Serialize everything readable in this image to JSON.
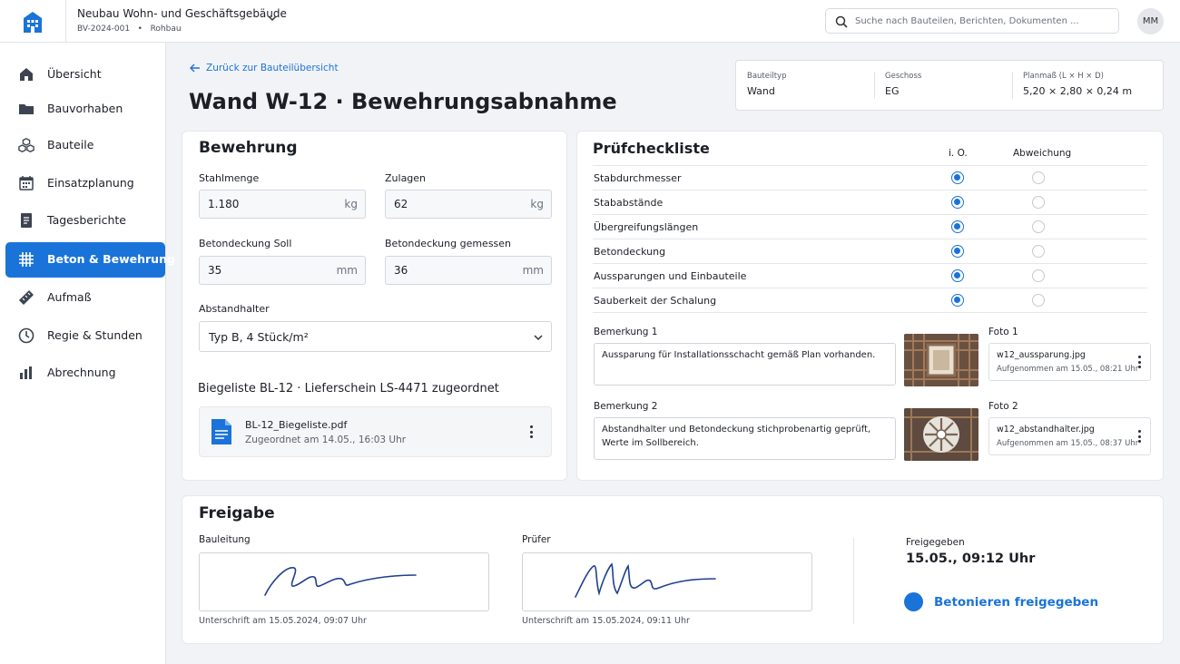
{
  "project": {
    "title": "Neubau Wohn- und Geschäftsgebäude",
    "subtitle": "BV-2024-001   •   Rohbau"
  },
  "search": {
    "placeholder": "Suche nach Bauteilen, Berichten, Dokumenten ..."
  },
  "user": {
    "initials": "MM"
  },
  "colors": {
    "accent": "#1a73d9",
    "background": "#f2f3f6"
  },
  "sidebar": {
    "items": [
      {
        "label": "Übersicht",
        "icon": "home-icon"
      },
      {
        "label": "Bauvorhaben",
        "icon": "folder-icon"
      },
      {
        "label": "Bauteile",
        "icon": "cubes-icon"
      },
      {
        "label": "Einsatzplanung",
        "icon": "calendar-icon"
      },
      {
        "label": "Tagesberichte",
        "icon": "document-icon"
      },
      {
        "label": "Beton & Bewehrung",
        "icon": "grid-icon",
        "active": true
      },
      {
        "label": "Aufmaß",
        "icon": "ruler-icon"
      },
      {
        "label": "Regie & Stunden",
        "icon": "clock-icon"
      },
      {
        "label": "Abrechnung",
        "icon": "bar-chart-icon"
      }
    ]
  },
  "main": {
    "back_link": "Zurück zur Bauteilübersicht",
    "title": "Wand W-12 · Bewehrungsabnahme",
    "meta": [
      {
        "key": "Bauteiltyp",
        "value": "Wand"
      },
      {
        "key": "Geschoss",
        "value": "EG"
      },
      {
        "key": "Planmaß (L × H × D)",
        "value": "5,20 × 2,80 × 0,24 m"
      }
    ]
  },
  "bewehrung": {
    "title": "Bewehrung",
    "stahlmenge": {
      "label": "Stahlmenge",
      "value": "1.180",
      "unit": "kg"
    },
    "zulagen": {
      "label": "Zulagen",
      "value": "62",
      "unit": "kg"
    },
    "betondeckung_soll": {
      "label": "Betondeckung Soll",
      "value": "35",
      "unit": "mm"
    },
    "betondeckung_gemessen": {
      "label": "Betondeckung gemessen",
      "value": "36",
      "unit": "mm"
    },
    "abstandhalter": {
      "label": "Abstandhalter",
      "value": "Typ B, 4 Stück/m²"
    },
    "biegeliste_title": "Biegeliste BL-12 · Lieferschein LS-4471 zugeordnet",
    "file": {
      "name": "BL-12_Biegeliste.pdf",
      "sub": "Zugeordnet am 14.05., 16:03 Uhr"
    }
  },
  "checklist": {
    "title": "Prüfcheckliste",
    "col_ok": "i. O.",
    "col_dev": "Abweichung",
    "rows": [
      {
        "label": "Stabdurchmesser",
        "ok": true
      },
      {
        "label": "Stababstände",
        "ok": true
      },
      {
        "label": "Übergreifungslängen",
        "ok": true
      },
      {
        "label": "Betondeckung",
        "ok": true
      },
      {
        "label": "Aussparungen und Einbauteile",
        "ok": true
      },
      {
        "label": "Sauberkeit der Schalung",
        "ok": true
      }
    ],
    "remarks": [
      {
        "label": "Bemerkung 1",
        "text": "Aussparung für Installationsschacht gemäß Plan vorhanden.",
        "photo_label": "Foto 1",
        "photo_name": "w12_aussparung.jpg",
        "photo_sub": "Aufgenommen am 15.05., 08:21 Uhr"
      },
      {
        "label": "Bemerkung 2",
        "text": "Abstandhalter und Betondeckung stichprobenartig geprüft, Werte im Sollbereich.",
        "photo_label": "Foto 2",
        "photo_name": "w12_abstandhalter.jpg",
        "photo_sub": "Aufgenommen am 15.05., 08:37 Uhr"
      }
    ]
  },
  "freigabe": {
    "title": "Freigabe",
    "bauleitung": {
      "label": "Bauleitung",
      "note": "Unterschrift am 15.05.2024, 09:07 Uhr"
    },
    "pruefer": {
      "label": "Prüfer",
      "note": "Unterschrift am 15.05.2024, 09:11 Uhr"
    },
    "status_label": "Freigegeben",
    "status_time": "15.05., 09:12 Uhr",
    "action": "Betonieren freigegeben"
  }
}
